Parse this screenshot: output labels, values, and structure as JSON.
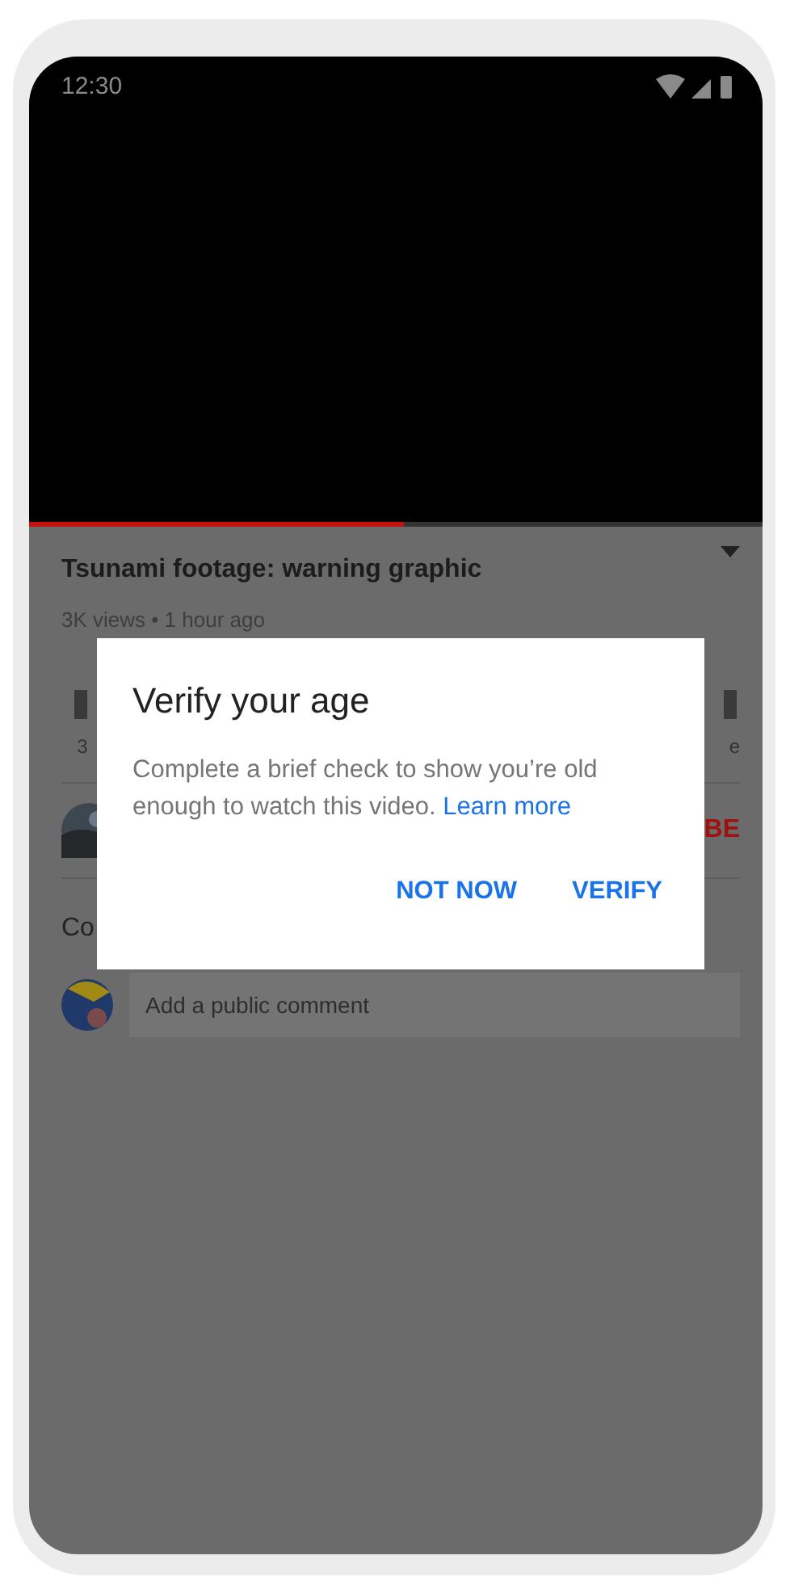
{
  "status_bar": {
    "time": "12:30"
  },
  "video": {
    "progress": {
      "level": 0.51
    }
  },
  "details": {
    "title": "Tsunami footage: warning graphic",
    "meta": "3K views • 1 hour ago"
  },
  "actions": [
    {
      "label": "3"
    },
    {
      "label": "e"
    }
  ],
  "channel": {
    "subscribe": "BE"
  },
  "comments": {
    "heading": "Co",
    "placeholder": "Add a public comment"
  },
  "dialog": {
    "title": "Verify your age",
    "body": "Complete a brief check to show you’re old enough to watch this video.",
    "link": "Learn more",
    "buttons": [
      "NOT NOW",
      "VERIFY"
    ]
  }
}
